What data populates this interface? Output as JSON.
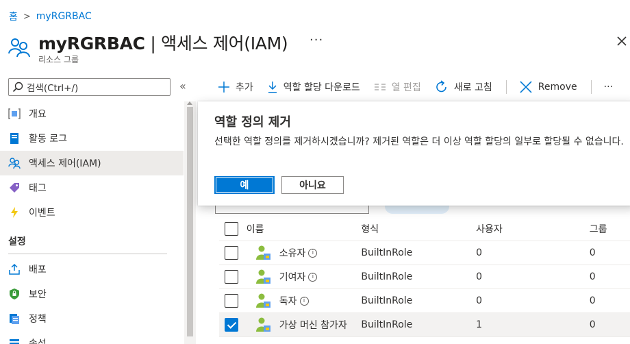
{
  "breadcrumb": {
    "home": "홈",
    "current": "myRGRBAC"
  },
  "header": {
    "title_name": "myRGRBAC",
    "title_rest": " | 액세스 제어(IAM)",
    "more": "···",
    "subtitle": "리소스 그룹",
    "close_icon": "close-icon"
  },
  "search": {
    "placeholder": "검색(Ctrl+/)",
    "collapse": "«"
  },
  "nav": {
    "items": [
      {
        "label": "개요",
        "icon": "resource-group-icon"
      },
      {
        "label": "활동 로그",
        "icon": "activity-log-icon"
      },
      {
        "label": "액세스 제어(IAM)",
        "icon": "iam-icon",
        "active": true
      },
      {
        "label": "태그",
        "icon": "tag-icon"
      },
      {
        "label": "이벤트",
        "icon": "event-icon"
      }
    ],
    "section_settings": "설정",
    "settings_items": [
      {
        "label": "배포",
        "icon": "deployment-icon"
      },
      {
        "label": "보안",
        "icon": "security-icon"
      },
      {
        "label": "정책",
        "icon": "policy-icon"
      },
      {
        "label": "속성",
        "icon": "properties-icon"
      }
    ]
  },
  "toolbar": {
    "add": "추가",
    "download": "역할 할당 다운로드",
    "edit_columns": "열 편집",
    "refresh": "새로 고침",
    "remove": "Remove",
    "more": "···"
  },
  "table": {
    "headers": {
      "name": "이름",
      "type": "형식",
      "users": "사용자",
      "groups": "그룹"
    },
    "rows": [
      {
        "name": "소유자",
        "type": "BuiltInRole",
        "users": "0",
        "groups": "0",
        "checked": false
      },
      {
        "name": "기여자",
        "type": "BuiltInRole",
        "users": "0",
        "groups": "0",
        "checked": false
      },
      {
        "name": "독자",
        "type": "BuiltInRole",
        "users": "0",
        "groups": "0",
        "checked": false
      },
      {
        "name": "가상 머신 참가자",
        "type": "BuiltInRole",
        "users": "1",
        "groups": "0",
        "checked": true
      }
    ]
  },
  "dialog": {
    "title": "역할 정의 제거",
    "message": "선택한 역할 정의를 제거하시겠습니까? 제거된 역할은 더 이상 역할 할당의 일부로 할당될 수 없습니다.",
    "yes": "예",
    "no": "아니요"
  },
  "colors": {
    "accent": "#0078d4",
    "selected_row": "#f3f2f1",
    "nav_active": "#edebe9"
  }
}
